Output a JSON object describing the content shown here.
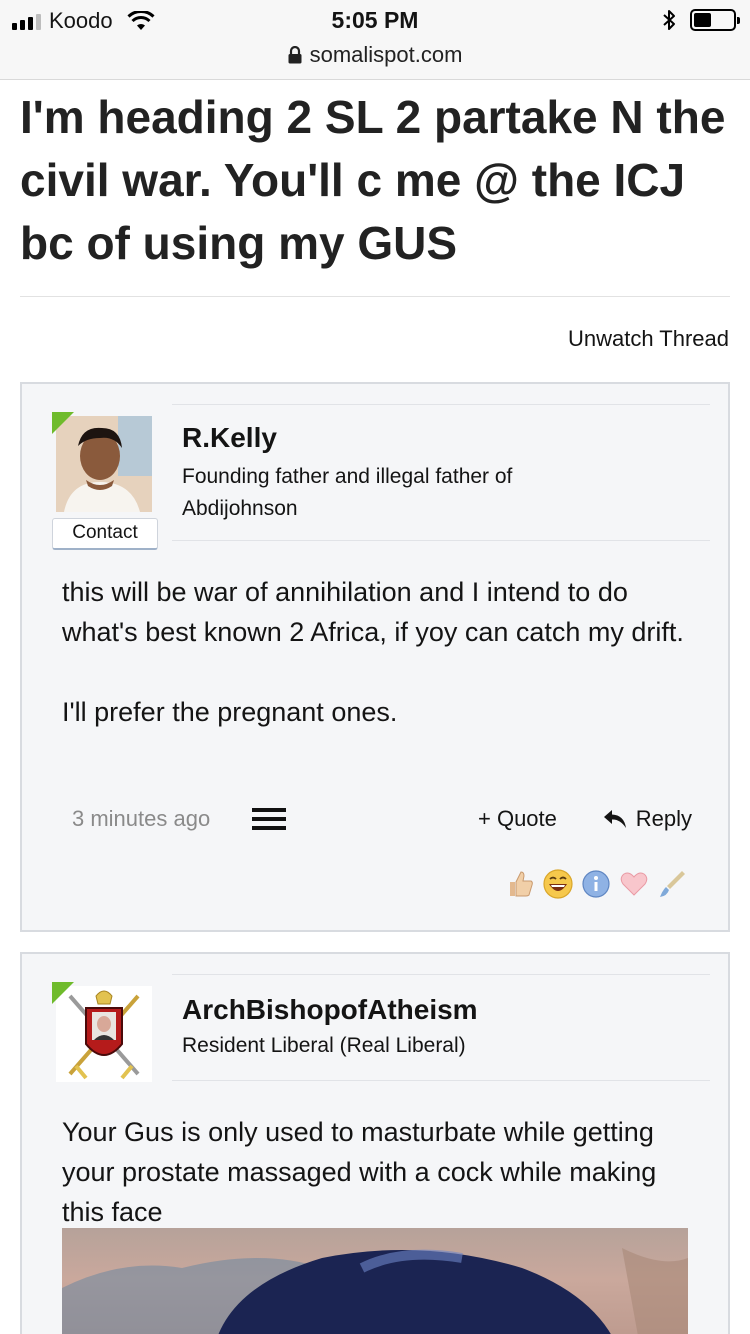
{
  "status_bar": {
    "carrier": "Koodo",
    "time": "5:05 PM",
    "url": "somalispot.com"
  },
  "thread": {
    "title": "I'm heading 2 SL 2 partake N the civil war. You'll c me @ the ICJ bc of using my GUS",
    "unwatch_label": "Unwatch Thread"
  },
  "posts": [
    {
      "username": "R.Kelly",
      "user_title": "Founding father and illegal father of Abdijohnson",
      "contact_label": "Contact",
      "message": [
        "this will be war of annihilation and I intend to do what's best known 2 Africa, if yoy can catch my drift.",
        "I'll prefer the pregnant ones."
      ],
      "timestamp": "3 minutes ago",
      "quote_label": "+ Quote",
      "reply_label": "Reply",
      "reactions": [
        "thumbs-up-icon",
        "laughing-face-icon",
        "info-icon",
        "heart-icon",
        "paintbrush-icon"
      ]
    },
    {
      "username": "ArchBishopofAtheism",
      "user_title": "Resident Liberal (Real Liberal)",
      "message": [
        "Your Gus is only used to masturbate while getting your prostate massaged with a cock while making this face"
      ]
    }
  ],
  "colors": {
    "online_indicator": "#6fbb2c",
    "post_background": "#f5f6f8",
    "post_border": "#d8dbe0",
    "timestamp": "#8a8a8a"
  }
}
